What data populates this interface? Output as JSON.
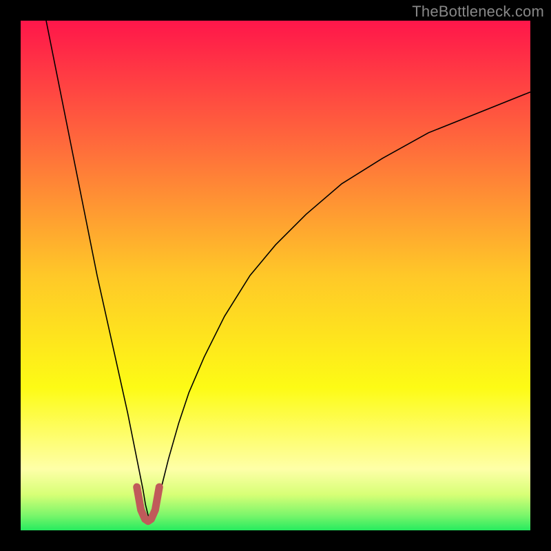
{
  "watermark": "TheBottleneck.com",
  "chart_data": {
    "type": "line",
    "title": "",
    "xlabel": "",
    "ylabel": "",
    "xlim": [
      0,
      100
    ],
    "ylim": [
      0,
      100
    ],
    "grid": false,
    "background_gradient": {
      "stops": [
        {
          "offset": 0.0,
          "color": "#ff164a"
        },
        {
          "offset": 0.25,
          "color": "#ff6d3b"
        },
        {
          "offset": 0.5,
          "color": "#ffc828"
        },
        {
          "offset": 0.72,
          "color": "#fdfb15"
        },
        {
          "offset": 0.88,
          "color": "#feffa8"
        },
        {
          "offset": 0.93,
          "color": "#d7ff76"
        },
        {
          "offset": 0.97,
          "color": "#7cf66b"
        },
        {
          "offset": 1.0,
          "color": "#26eb5f"
        }
      ]
    },
    "series": [
      {
        "name": "bottleneck-curve",
        "color": "#000000",
        "width": 1.6,
        "x": [
          5,
          7,
          9,
          11,
          13,
          15,
          17,
          19,
          21,
          22,
          23,
          24,
          24.5,
          25,
          25.5,
          26,
          27,
          28,
          29,
          31,
          33,
          36,
          40,
          45,
          50,
          56,
          63,
          71,
          80,
          90,
          100
        ],
        "y": [
          100,
          90,
          80,
          70,
          60,
          50,
          41,
          32,
          23,
          18,
          13,
          8,
          5,
          3,
          2,
          3,
          6,
          10,
          14,
          21,
          27,
          34,
          42,
          50,
          56,
          62,
          68,
          73,
          78,
          82,
          86
        ]
      }
    ],
    "highlight": {
      "name": "minimum-region",
      "color": "#c05a5a",
      "width": 11,
      "x": [
        22.8,
        23.6,
        24.4,
        25.0,
        25.6,
        26.4,
        27.2
      ],
      "y": [
        8.5,
        4.0,
        2.2,
        1.8,
        2.2,
        4.0,
        8.5
      ]
    }
  }
}
